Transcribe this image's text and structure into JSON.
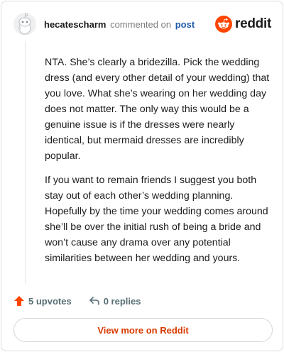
{
  "header": {
    "author": "hecatescharm",
    "action": "commented on",
    "target": "post",
    "brand": "reddit"
  },
  "comment": {
    "paragraphs": [
      "NTA. She’s clearly a bridezilla. Pick the wedding dress (and every other detail of your wedding) that you love. What she’s wearing on her wedding day does not matter. The only way this would be a genuine issue is if the dresses were nearly identical, but mermaid dresses are incredibly popular.",
      "If you want to remain friends I suggest you both stay out of each other’s wedding planning. Hopefully by the time your wedding comes around she’ll be over the initial rush of being a bride and won’t cause any drama over any potential similarities between her wedding and yours."
    ]
  },
  "actions": {
    "upvotes": "5 upvotes",
    "replies": "0 replies"
  },
  "footer": {
    "view_more": "View more on Reddit"
  },
  "colors": {
    "brand_orange": "#ff4500",
    "upvote": "#ff4500",
    "link": "#1f5aa8",
    "view_more_text": "#d93a00"
  },
  "icons": {
    "avatar": "snoo-avatar-icon",
    "brand": "reddit-logo-icon",
    "upvote": "upvote-arrow-icon",
    "reply": "reply-arrow-icon"
  }
}
